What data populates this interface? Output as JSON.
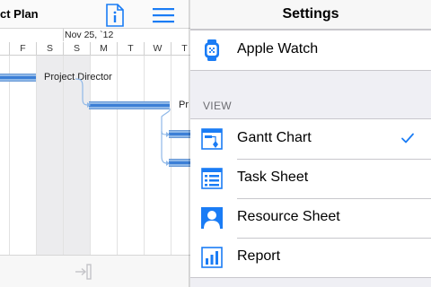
{
  "gantt": {
    "title": "ct Plan",
    "week_label": "Nov 25, `12",
    "days": [
      "F",
      "S",
      "S",
      "M",
      "T",
      "W",
      "T"
    ],
    "tasks": [
      {
        "label": "Project Director"
      },
      {
        "label": "Pr"
      }
    ]
  },
  "settings": {
    "title": "Settings",
    "top_items": [
      {
        "label": "Apple Watch",
        "icon": "apple-watch-icon"
      }
    ],
    "view_section": {
      "header": "VIEW",
      "items": [
        {
          "label": "Gantt Chart",
          "icon": "gantt-chart-icon",
          "selected": true
        },
        {
          "label": "Task Sheet",
          "icon": "task-sheet-icon",
          "selected": false
        },
        {
          "label": "Resource Sheet",
          "icon": "resource-sheet-icon",
          "selected": false
        },
        {
          "label": "Report",
          "icon": "report-icon",
          "selected": false
        }
      ]
    }
  },
  "colors": {
    "accent": "#1a7cf5",
    "bar_fill": "#8fb8e8",
    "bar_core": "#3c7fd6",
    "weekend_shade": "#ececee"
  }
}
